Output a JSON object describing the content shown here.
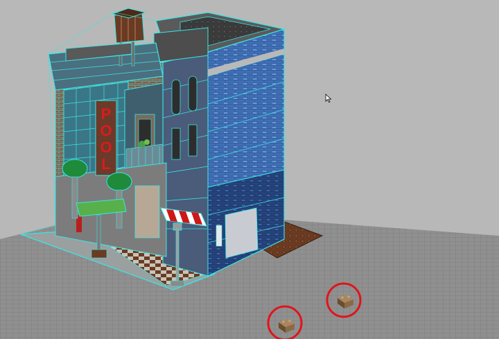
{
  "viewport": {
    "background_color": "#b8b8b8",
    "wireframe_color": "#39e6e6",
    "selection_circle_color": "#e0141c",
    "cursor_icon": "arrow-cursor-icon"
  },
  "model": {
    "sign_letters": [
      "P",
      "O",
      "O",
      "L"
    ],
    "colors": {
      "brick_brown": "#8a5a44",
      "brick_dark": "#5a3a2e",
      "blue_tower": "#3f6fb4",
      "blue_tower_light": "#6f97d6",
      "blue_tower_dark": "#26447c",
      "roof_dark": "#3b3b3b",
      "sign_red": "#d81c1c",
      "awning_red": "#cc1818",
      "tree_green": "#1e8a3a",
      "baseplate_gray": "#8d8d8d",
      "brown_plate": "#6a3b22",
      "tan_brick": "#8a6a45"
    }
  },
  "selected_parts": [
    {
      "name": "loose-tan-brick-1"
    },
    {
      "name": "loose-tan-brick-2"
    }
  ]
}
